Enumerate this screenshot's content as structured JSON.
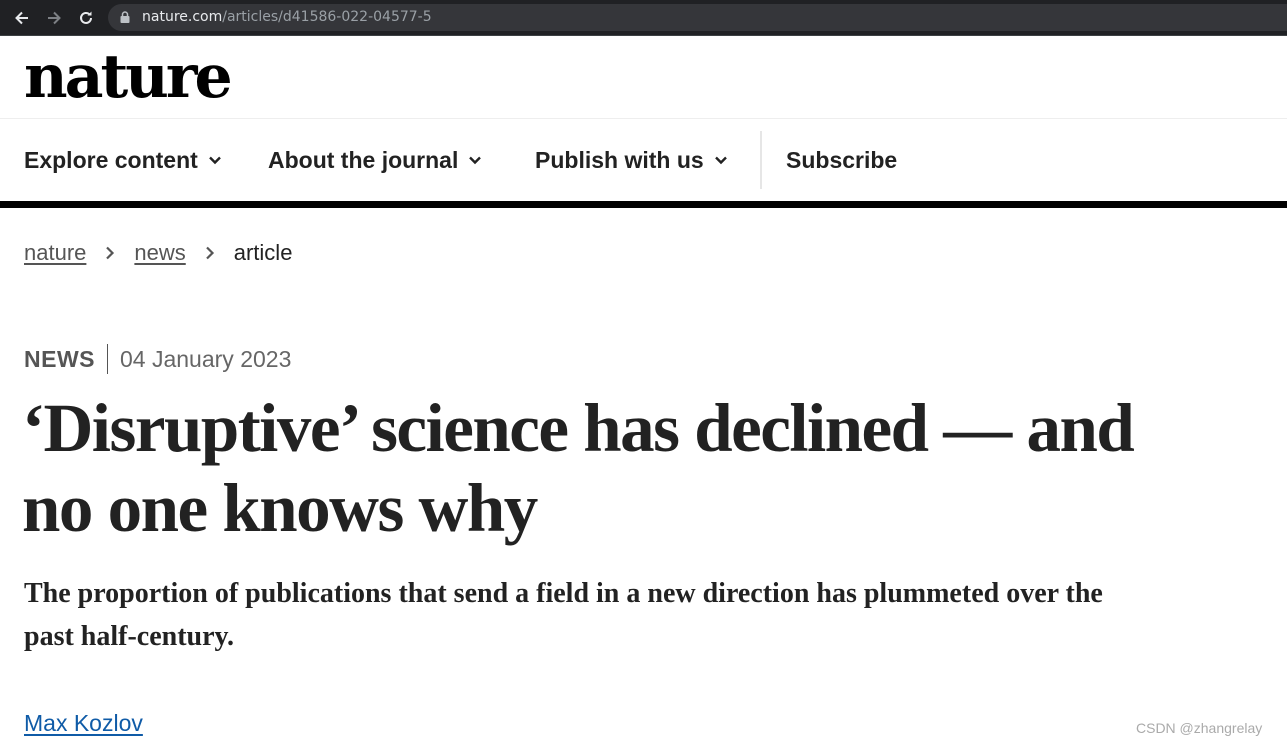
{
  "browser": {
    "url_domain": "nature.com",
    "url_path": "/articles/d41586-022-04577-5"
  },
  "site": {
    "logo": "nature"
  },
  "nav": {
    "items": [
      {
        "label": "Explore content"
      },
      {
        "label": "About the journal"
      },
      {
        "label": "Publish with us"
      }
    ],
    "subscribe_label": "Subscribe"
  },
  "breadcrumb": {
    "items": [
      "nature",
      "news"
    ],
    "current": "article"
  },
  "article": {
    "type": "NEWS",
    "date": "04 January 2023",
    "title": "‘Disruptive’ science has declined — and no one knows why",
    "standfirst": "The proportion of publications that send a field in a new direction has plummeted over the past half-century.",
    "author": "Max Kozlov"
  },
  "watermark": "CSDN @zhangrelay",
  "colors": {
    "author_link": "#0f5ba7",
    "browser_bar": "#202124"
  }
}
